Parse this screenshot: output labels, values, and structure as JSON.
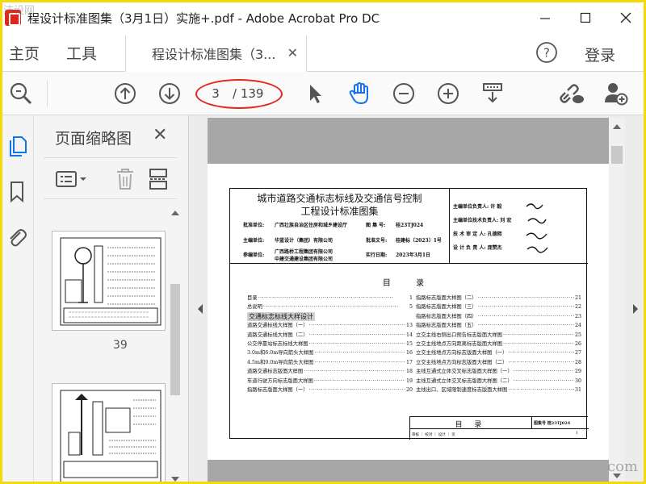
{
  "window": {
    "title": "程设计标准图集（3月1日）实施+.pdf - Adobe Acrobat Pro DC",
    "watermark_top": "洁设网",
    "watermark_bottom": "com"
  },
  "menubar": {
    "home": "主页",
    "tools": "工具",
    "doc_tab": "程设计标准图集（3...",
    "login": "登录"
  },
  "toolbar": {
    "current_page": "3",
    "total_pages": "/ 139"
  },
  "thumbnails": {
    "title": "页面缩略图",
    "page_label": "39"
  },
  "document": {
    "title_line1": "城市道路交通标志标线及交通信号控制",
    "title_line2": "工程设计标准图集",
    "approval_unit_label": "批准单位:",
    "approval_unit": "广西壮族自治区住房和城乡建设厅",
    "atlas_no_label": "图 集 号:",
    "atlas_no": "桂23TJ024",
    "editor_unit_label": "主编单位:",
    "editor_unit": "华蓝设计（集团）有限公司",
    "approval_doc_label": "批准文号:",
    "approval_doc": "桂建标〔2023〕1号",
    "participant_label": "参编单位:",
    "participant_1": "广西路桥工程集团有限公司",
    "participant_2": "中建交通建设集团有限公司",
    "effective_label": "实行日期:",
    "effective_date": "2023年3月1日",
    "leader_1": "主编单位负责人: 许 毅",
    "leader_2": "主编单位技术负责人: 刘 宏",
    "review": "技 术 审 定 人: 孔德熙",
    "design": "设 计 负 责 人: 庞赞杰",
    "toc_title": "目 录",
    "toc_left": [
      {
        "label": "目录",
        "page": "1"
      },
      {
        "label": "总说明",
        "page": "5"
      },
      {
        "label": "交通标志标线大样设计",
        "page": "",
        "highlight": true
      },
      {
        "label": "道路交通标线大样图（一）",
        "page": "13"
      },
      {
        "label": "道路交通标线大样图（二）",
        "page": "14"
      },
      {
        "label": "公交停靠站标志标线大样图",
        "page": "15"
      },
      {
        "label": "3.0m和6.0m导向箭头大样图",
        "page": "16"
      },
      {
        "label": "4.5m和9.0m导向箭头大样图",
        "page": "17"
      },
      {
        "label": "道路交通标志版面大样图",
        "page": "18"
      },
      {
        "label": "车道行驶方向标志版面大样图",
        "page": "19"
      },
      {
        "label": "指路标志版面大样图（一）",
        "page": "20"
      }
    ],
    "toc_right": [
      {
        "label": "指路标志版面大样图（二）",
        "page": "21"
      },
      {
        "label": "指路标志版面大样图（三）",
        "page": "22"
      },
      {
        "label": "指路标志版面大样图（四）",
        "page": "23"
      },
      {
        "label": "指路标志版面大样图（五）",
        "page": "24"
      },
      {
        "label": "立交主线右侧出口预告标志版面大样图",
        "page": "25"
      },
      {
        "label": "立交主线地点方向距离标志版面大样图",
        "page": "26"
      },
      {
        "label": "立交主线地点方向标志版面大样图（一）",
        "page": "27"
      },
      {
        "label": "立交主线地点方向标志版面大样图（二）",
        "page": "28"
      },
      {
        "label": "主线互通式立体交叉标志版面大样图（一）",
        "page": "29"
      },
      {
        "label": "主线互通式立体交叉标志版面大样图（二）",
        "page": "30"
      },
      {
        "label": "主线出口、区域限制速度标志版面大样图",
        "page": "31"
      }
    ],
    "footer_title": "目 录",
    "footer_code": "图集号  桂23TJ024",
    "footer_row": "审核 ｜ 校对 ｜ 设计 ｜ 页",
    "footer_page": "1"
  }
}
